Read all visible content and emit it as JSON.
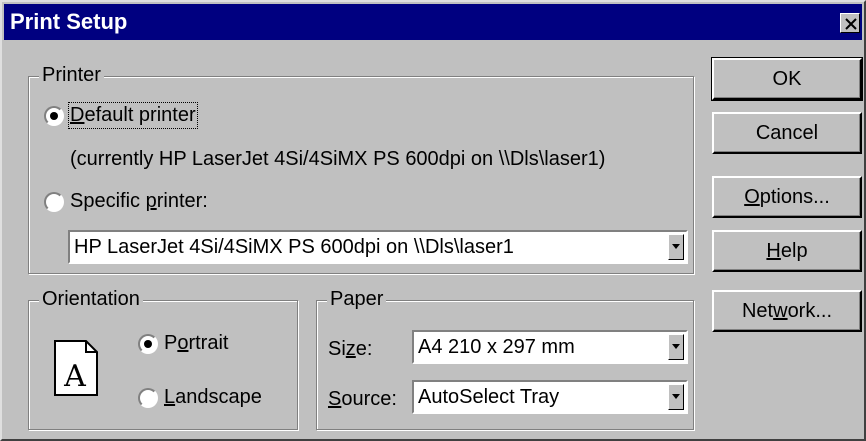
{
  "window": {
    "title": "Print Setup"
  },
  "printer": {
    "legend": "Printer",
    "default_label_pre": "",
    "default_label_u": "D",
    "default_label_post": "efault printer",
    "current": "(currently HP LaserJet 4Si/4SiMX PS 600dpi on \\\\Dls\\laser1)",
    "specific_label_pre": "Specific ",
    "specific_label_u": "p",
    "specific_label_post": "rinter:",
    "specific_value": "HP LaserJet 4Si/4SiMX PS 600dpi on \\\\Dls\\laser1",
    "selected": "default"
  },
  "orientation": {
    "legend": "Orientation",
    "portrait_pre": "P",
    "portrait_u": "o",
    "portrait_post": "rtrait",
    "landscape_pre": "",
    "landscape_u": "L",
    "landscape_post": "andscape",
    "selected": "portrait",
    "icon_letter": "A"
  },
  "paper": {
    "legend": "Paper",
    "size_pre": "Si",
    "size_u": "z",
    "size_post": "e:",
    "size_value": "A4 210 x 297 mm",
    "source_pre": "",
    "source_u": "S",
    "source_post": "ource:",
    "source_value": "AutoSelect Tray"
  },
  "buttons": {
    "ok": "OK",
    "cancel": "Cancel",
    "options_u": "O",
    "options_post": "ptions...",
    "help_u": "H",
    "help_post": "elp",
    "network_pre": "Net",
    "network_u": "w",
    "network_post": "ork..."
  }
}
